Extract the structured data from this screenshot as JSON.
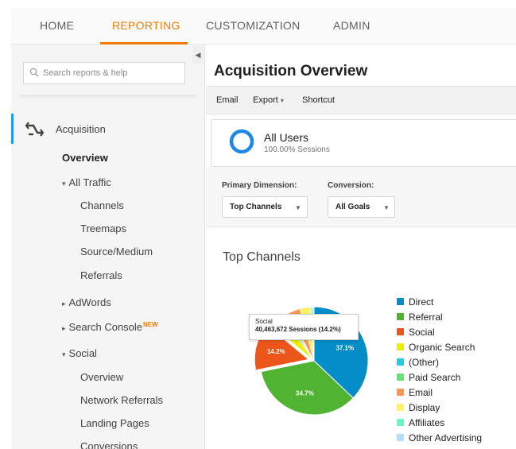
{
  "topnav": {
    "tabs": [
      {
        "label": "HOME"
      },
      {
        "label": "REPORTING"
      },
      {
        "label": "CUSTOMIZATION"
      },
      {
        "label": "ADMIN"
      }
    ],
    "active_tab": "REPORTING"
  },
  "sidebar": {
    "search_placeholder": "Search reports & help",
    "section": "Acquisition",
    "overview": "Overview",
    "all_traffic": "All Traffic",
    "all_traffic_items": [
      "Channels",
      "Treemaps",
      "Source/Medium",
      "Referrals"
    ],
    "adwords": "AdWords",
    "search_console": "Search Console",
    "search_console_badge": "NEW",
    "social": "Social",
    "social_items": [
      "Overview",
      "Network Referrals",
      "Landing Pages",
      "Conversions"
    ]
  },
  "main": {
    "title": "Acquisition Overview",
    "actions": [
      "Email",
      "Export",
      "Shortcut"
    ],
    "segment": {
      "name": "All Users",
      "sub": "100.00% Sessions"
    },
    "primary_dimension_label": "Primary Dimension:",
    "primary_dimension_value": "Top Channels",
    "conversion_label": "Conversion:",
    "conversion_value": "All Goals",
    "chart_title": "Top Channels",
    "tooltip": {
      "title": "Social",
      "value": "40,463,672 Sessions (14.2%)"
    }
  },
  "colors": {
    "accent": "#f57c00",
    "active_indicator": "#2196f3",
    "segment_ring": "#1e88e5"
  },
  "chart_data": {
    "type": "pie",
    "title": "Top Channels",
    "slice_labels_shown": [
      "37.1%",
      "34.7%",
      "14.2%"
    ],
    "slices": [
      {
        "name": "Direct",
        "value": 37.1,
        "color": "#058dc7"
      },
      {
        "name": "Referral",
        "value": 34.7,
        "color": "#50b432"
      },
      {
        "name": "Social",
        "value": 14.2,
        "color": "#ed561b"
      },
      {
        "name": "Organic Search",
        "value": 4.2,
        "color": "#edef00"
      },
      {
        "name": "(Other)",
        "value": 1.0,
        "color": "#24cbe5"
      },
      {
        "name": "Paid Search",
        "value": 0.8,
        "color": "#64e572"
      },
      {
        "name": "Email",
        "value": 3.8,
        "color": "#ff9655"
      },
      {
        "name": "Display",
        "value": 3.2,
        "color": "#fff263"
      },
      {
        "name": "Affiliates",
        "value": 0.6,
        "color": "#6af9c4"
      },
      {
        "name": "Other Advertising",
        "value": 0.4,
        "color": "#b2deff"
      }
    ],
    "exploded_slice": "Social",
    "legend_position": "right"
  }
}
